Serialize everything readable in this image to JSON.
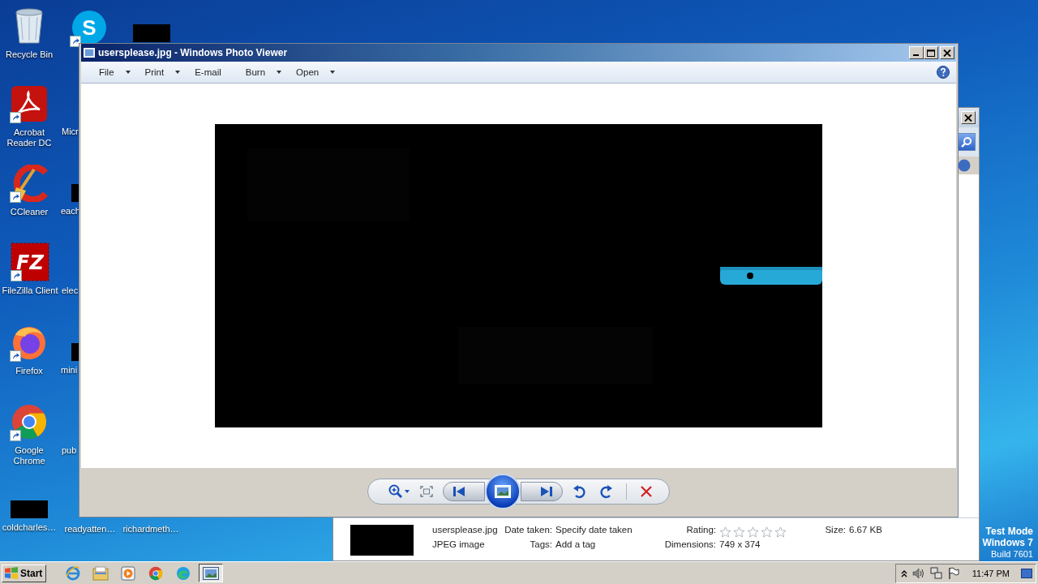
{
  "desktop_icons": [
    {
      "label": "Recycle Bin",
      "kind": "bin",
      "shortcut": false
    },
    {
      "label": "Acrobat Reader DC",
      "kind": "pdf",
      "shortcut": true
    },
    {
      "label": "CCleaner",
      "kind": "cleaner",
      "shortcut": true
    },
    {
      "label": "FileZilla Client",
      "kind": "ftp",
      "glyph": "FZ",
      "shortcut": true
    },
    {
      "label": "Firefox",
      "kind": "firefox",
      "shortcut": true
    },
    {
      "label": "Google Chrome",
      "kind": "chrome",
      "shortcut": true
    },
    {
      "label": "coldcharles…",
      "kind": "blank",
      "shortcut": false
    },
    {
      "kind": "skype",
      "glyph": "S",
      "shortcut": true
    },
    {
      "label": "Micr",
      "kind": "none",
      "shortcut": false
    },
    {
      "label": "each",
      "kind": "blank",
      "shortcut": false
    },
    {
      "label": "elec",
      "kind": "none",
      "shortcut": false
    },
    {
      "label": "mini",
      "kind": "blank",
      "shortcut": false
    },
    {
      "label": "pub",
      "kind": "none",
      "shortcut": false
    },
    {
      "label": "readyatten…",
      "kind": "none",
      "shortcut": false
    },
    {
      "kind": "blank",
      "shortcut": false
    },
    {
      "label": "richardmeth…",
      "kind": "none",
      "shortcut": false
    }
  ],
  "explorer_window": {
    "details": {
      "file_name": "usersplease.jpg",
      "file_type": "JPEG image",
      "date_taken": {
        "label": "Date taken:",
        "value": "Specify date taken"
      },
      "tags": {
        "label": "Tags:",
        "value": "Add a tag"
      },
      "rating": {
        "label": "Rating:",
        "stars": 0
      },
      "dimensions": {
        "label": "Dimensions:",
        "value": "749 x 374"
      },
      "size": {
        "label": "Size:",
        "value": "6.67 KB"
      }
    }
  },
  "photo_viewer": {
    "title": "usersplease.jpg - Windows Photo Viewer",
    "menu": [
      {
        "label": "File",
        "dropdown": true
      },
      {
        "label": "Print",
        "dropdown": true
      },
      {
        "label": "E-mail",
        "dropdown": false
      },
      {
        "label": "Burn",
        "dropdown": true
      },
      {
        "label": "Open",
        "dropdown": true
      }
    ],
    "toolbar": [
      {
        "kind": "zoom"
      },
      {
        "kind": "fit"
      },
      {
        "kind": "previous"
      },
      {
        "kind": "slideshow"
      },
      {
        "kind": "next"
      },
      {
        "kind": "rotate-left"
      },
      {
        "kind": "rotate-right"
      },
      {
        "kind": "delete"
      }
    ]
  },
  "os_watermark": [
    "Test Mode",
    "Windows 7",
    "Build 7601"
  ],
  "taskbar": {
    "start": "Start",
    "buttons": [
      {
        "kind": "ie",
        "selected": false
      },
      {
        "kind": "explorer",
        "selected": false
      },
      {
        "kind": "media",
        "selected": false
      },
      {
        "kind": "chrome",
        "selected": false
      },
      {
        "kind": "edge",
        "selected": false
      },
      {
        "kind": "photos",
        "selected": true
      }
    ],
    "tray": [
      {
        "kind": "chevron"
      },
      {
        "kind": "speaker"
      },
      {
        "kind": "network"
      },
      {
        "kind": "flag"
      }
    ],
    "clock": "11:47 PM"
  }
}
